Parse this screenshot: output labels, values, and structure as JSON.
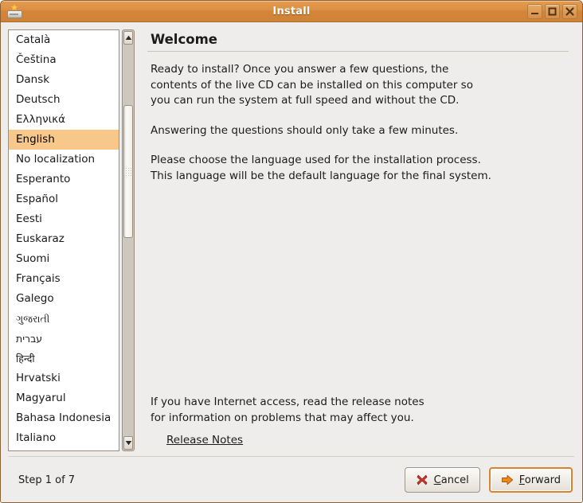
{
  "window": {
    "title": "Install",
    "icon": "cd-installer-icon",
    "controls": [
      {
        "name": "minimize-button",
        "glyph": "minimize-icon"
      },
      {
        "name": "maximize-button",
        "glyph": "maximize-icon"
      },
      {
        "name": "close-button",
        "glyph": "close-icon"
      }
    ]
  },
  "language_list": {
    "selected": "English",
    "items": [
      {
        "label": "Català",
        "script": false
      },
      {
        "label": "Čeština",
        "script": false
      },
      {
        "label": "Dansk",
        "script": false
      },
      {
        "label": "Deutsch",
        "script": false
      },
      {
        "label": "Ελληνικά",
        "script": false
      },
      {
        "label": "English",
        "script": false
      },
      {
        "label": "No localization",
        "script": false
      },
      {
        "label": "Esperanto",
        "script": false
      },
      {
        "label": "Español",
        "script": false
      },
      {
        "label": "Eesti",
        "script": false
      },
      {
        "label": "Euskaraz",
        "script": false
      },
      {
        "label": "Suomi",
        "script": false
      },
      {
        "label": "Français",
        "script": false
      },
      {
        "label": "Galego",
        "script": false
      },
      {
        "label": "ગુજરાતી",
        "script": true
      },
      {
        "label": "עברית",
        "script": true
      },
      {
        "label": "हिन्दी",
        "script": true
      },
      {
        "label": "Hrvatski",
        "script": false
      },
      {
        "label": "Magyarul",
        "script": false
      },
      {
        "label": "Bahasa Indonesia",
        "script": false
      },
      {
        "label": "Italiano",
        "script": false
      }
    ]
  },
  "main": {
    "heading": "Welcome",
    "paragraph1": "Ready to install? Once you answer a few questions, the\ncontents of the live CD can be installed on this computer so\nyou can run the system at full speed and without the CD.",
    "paragraph2": "Answering the questions should only take a few minutes.",
    "paragraph3": "Please choose the language used for the installation process.\nThis language will be the default language for the final system.",
    "release_paragraph": "If you have Internet access, read the release notes\nfor information on problems that may affect you.",
    "release_link": "Release Notes"
  },
  "footer": {
    "step": "Step 1 of 7",
    "cancel": {
      "pre": "",
      "mnemonic": "C",
      "post": "ancel"
    },
    "forward": {
      "pre": "",
      "mnemonic": "F",
      "post": "orward"
    }
  },
  "colors": {
    "titlebar": "#dd9145",
    "selection": "#f8c88a",
    "focus_ring": "#d4862f",
    "window_bg": "#efedeb",
    "cancel_icon": "#cc2222",
    "forward_icon": "#f0881d"
  }
}
